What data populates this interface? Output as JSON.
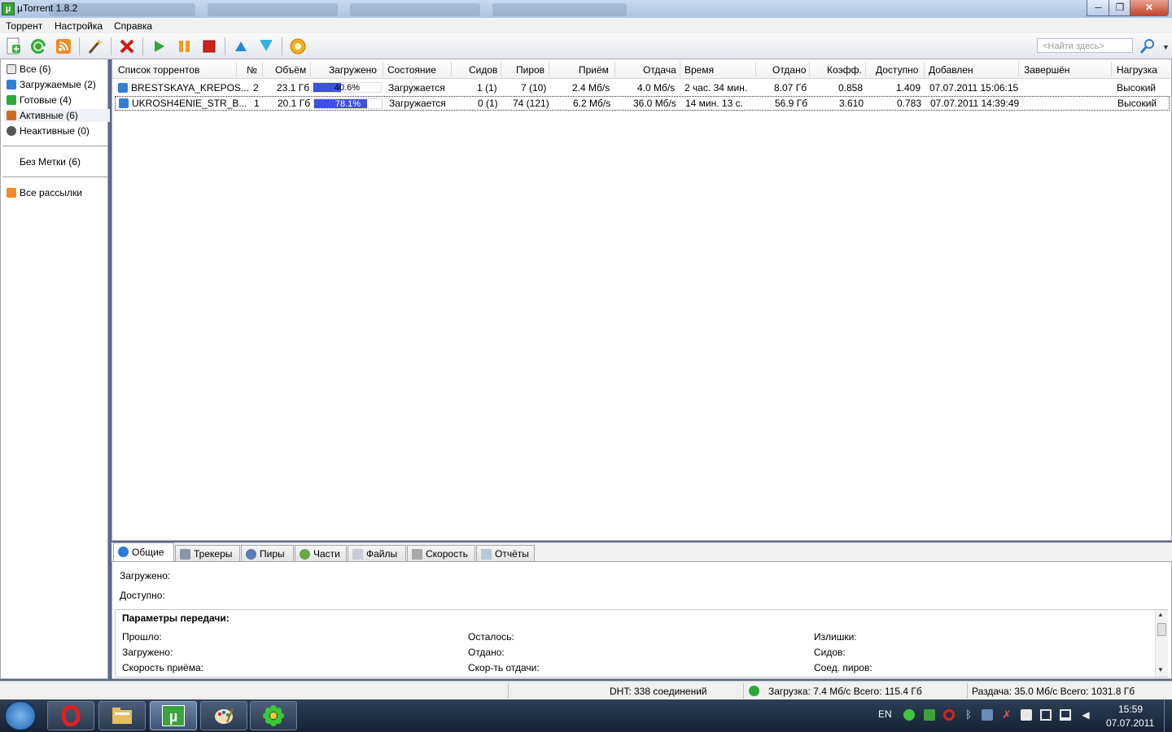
{
  "window": {
    "title": "µTorrent 1.8.2",
    "buttons": {
      "minimize": "─",
      "maximize": "❐",
      "close": "✕"
    }
  },
  "menu": [
    "Торрент",
    "Настройка",
    "Справка"
  ],
  "toolbar": {
    "search_placeholder": "<Найти здесь>",
    "icons": [
      "add-torrent-icon",
      "add-url-icon",
      "rss-icon",
      "create-torrent-icon",
      "remove-icon",
      "start-icon",
      "pause-icon",
      "stop-icon",
      "move-up-icon",
      "move-down-icon",
      "preferences-icon",
      "search-icon"
    ]
  },
  "sidebar": {
    "items": [
      {
        "label": "Все (6)",
        "icon": "all-icon"
      },
      {
        "label": "Загружаемые (2)",
        "icon": "downloading-icon"
      },
      {
        "label": "Готовые (4)",
        "icon": "completed-icon"
      },
      {
        "label": "Активные (6)",
        "icon": "active-icon"
      },
      {
        "label": "Неактивные (0)",
        "icon": "inactive-icon"
      }
    ],
    "labels_item": "Без Метки (6)",
    "feeds_item": "Все рассылки"
  },
  "columns": [
    "Список торрентов",
    "№",
    "Объём",
    "Загружено",
    "Состояние",
    "Сидов",
    "Пиров",
    "Приём",
    "Отдача",
    "Время",
    "Отдано",
    "Коэфф.",
    "Доступно",
    "Добавлен",
    "Завершён",
    "Нагрузка"
  ],
  "torrents": [
    {
      "name": "BRESTSKAYA_KREPOS...",
      "num": "2",
      "size": "23.1 Гб",
      "done": "40.6%",
      "done_value": 0.406,
      "status": "Загружается",
      "seeds": "1 (1)",
      "peers": "7 (10)",
      "down": "2.4 Мб/s",
      "up": "4.0 Мб/s",
      "eta": "2 час. 34 мин.",
      "uploaded": "8.07 Гб",
      "ratio": "0.858",
      "avail": "1.409",
      "added": "07.07.2011 15:06:15",
      "completed": "",
      "priority": "Высокий"
    },
    {
      "name": "UKROSH4ENIE_STR_B...",
      "num": "1",
      "size": "20.1 Гб",
      "done": "78.1%",
      "done_value": 0.781,
      "status": "Загружается",
      "seeds": "0 (1)",
      "peers": "74 (121)",
      "down": "6.2 Мб/s",
      "up": "36.0 Мб/s",
      "eta": "14 мин. 13 с.",
      "uploaded": "56.9 Гб",
      "ratio": "3.610",
      "avail": "0.783",
      "added": "07.07.2011 14:39:49",
      "completed": "",
      "priority": "Высокий"
    }
  ],
  "tabs": [
    "Общие",
    "Трекеры",
    "Пиры",
    "Части",
    "Файлы",
    "Скорость",
    "Отчёты"
  ],
  "details": {
    "downloaded_label": "Загружено:",
    "available_label": "Доступно:",
    "group_title": "Параметры передачи:",
    "col1": [
      "Прошло:",
      "Загружено:",
      "Скорость приёма:"
    ],
    "col2": [
      "Осталось:",
      "Отдано:",
      "Скор-ть отдачи:"
    ],
    "col3": [
      "Излишки:",
      "Сидов:",
      "Соед. пиров:"
    ]
  },
  "statusbar": {
    "dht": "DHT: 338 соединений",
    "download": "Загрузка: 7.4 Мб/с Всего: 115.4 Гб",
    "upload": "Раздача: 35.0 Мб/с Всего: 1031.8 Гб"
  },
  "taskbar": {
    "apps": [
      "opera-icon",
      "explorer-icon",
      "utorrent-icon",
      "paint-icon",
      "icq-icon"
    ],
    "utorrent_glyph": "µ",
    "lang": "EN",
    "time": "15:59",
    "date": "07.07.2011"
  },
  "colors": {
    "progress": "#3e4fe8",
    "accent": "#2f7fd8"
  }
}
